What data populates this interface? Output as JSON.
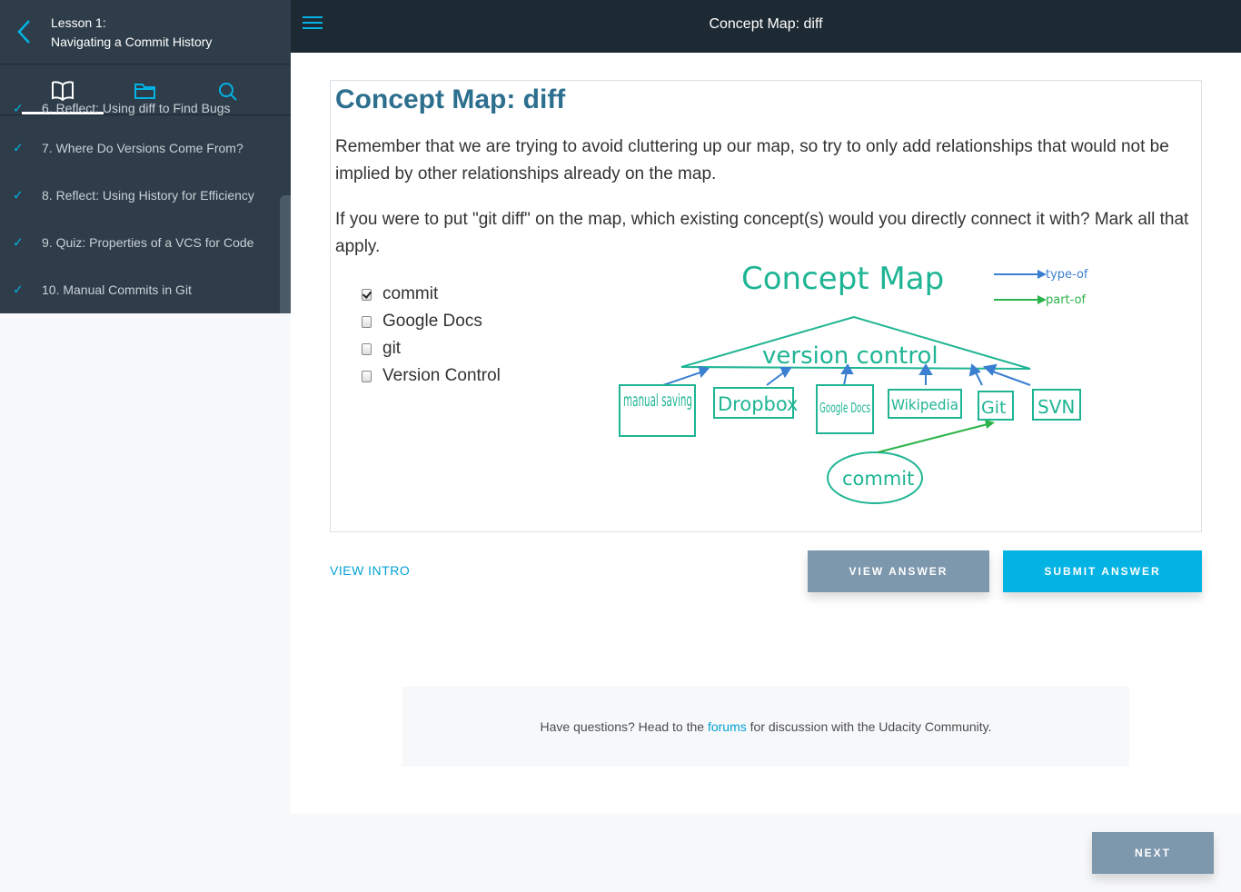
{
  "sidebar": {
    "lesson_line1": "Lesson 1:",
    "lesson_line2": "Navigating a Commit History",
    "tabs": [
      "book-icon",
      "folder-icon",
      "search-icon"
    ],
    "items": [
      {
        "label": "6. Reflect: Using diff to Find Bugs",
        "done": true
      },
      {
        "label": "7. Where Do Versions Come From?",
        "done": true
      },
      {
        "label": "8. Reflect: Using History for Efficiency",
        "done": true
      },
      {
        "label": "9. Quiz: Properties of a VCS for Code",
        "done": true
      },
      {
        "label": "10. Manual Commits in Git",
        "done": true
      }
    ]
  },
  "topbar": {
    "title": "Concept Map: diff"
  },
  "quiz": {
    "title": "Concept Map: diff",
    "para1": "Remember that we are trying to avoid cluttering up our map, so try to only add relationships that would not be implied by other relationships already on the map.",
    "para2": "If you were to put \"git diff\" on the map, which existing concept(s) would you directly connect it with? Mark all that apply.",
    "options": [
      {
        "label": "commit",
        "checked": true
      },
      {
        "label": "Google Docs",
        "checked": false
      },
      {
        "label": "git",
        "checked": false
      },
      {
        "label": "Version Control",
        "checked": false
      }
    ],
    "map": {
      "title": "Concept Map",
      "legend_type": "type-of",
      "legend_part": "part-of",
      "root": "version control",
      "nodes": [
        "manual saving",
        "Dropbox",
        "Google Docs",
        "Wikipedia",
        "Git",
        "SVN"
      ],
      "child": "commit",
      "colors": {
        "teal": "#1fb594",
        "blue": "#3a7fd0",
        "green": "#2bb34a"
      }
    }
  },
  "actions": {
    "view_intro": "VIEW INTRO",
    "view_answer": "VIEW ANSWER",
    "submit_answer": "SUBMIT ANSWER"
  },
  "forum": {
    "prefix": "Have questions? Head to the ",
    "link": "forums",
    "suffix": " for discussion with the Udacity Community."
  },
  "footer": {
    "next": "NEXT"
  }
}
